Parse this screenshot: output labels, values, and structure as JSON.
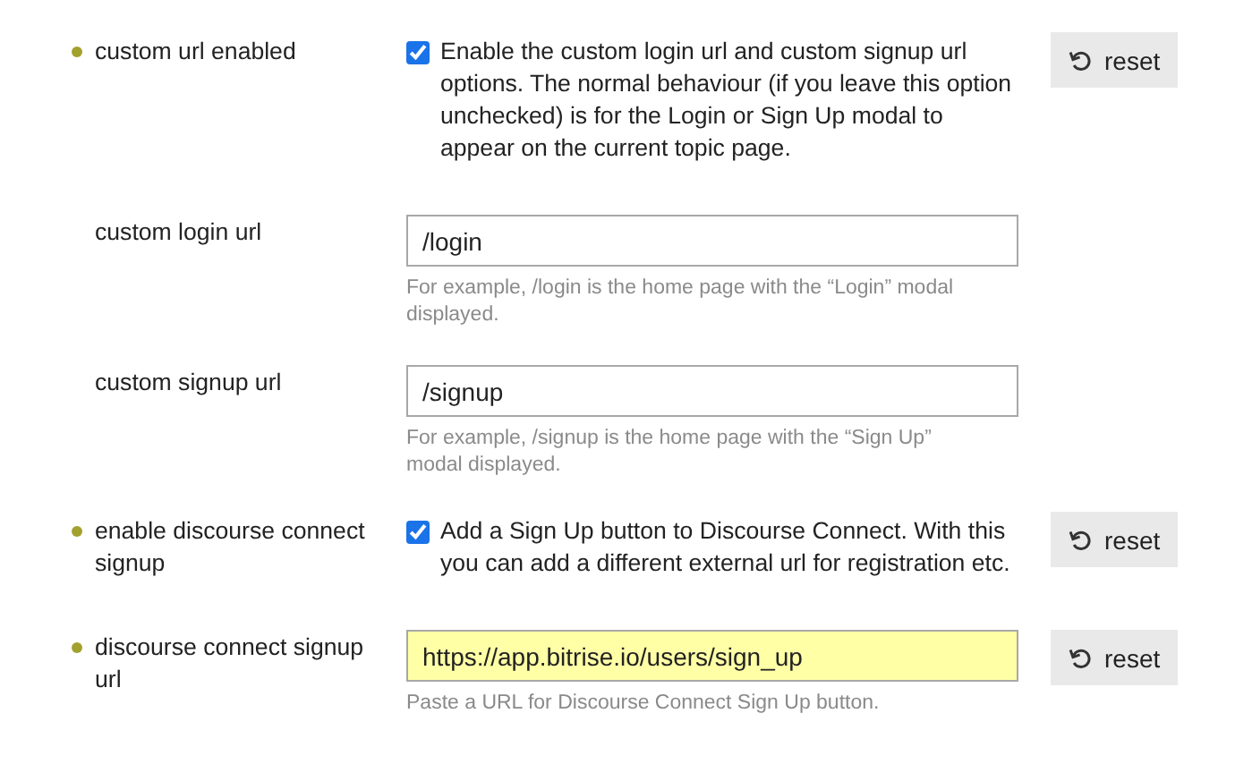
{
  "settings": [
    {
      "kind": "checkbox",
      "label": "custom url enabled",
      "modified": true,
      "checked": true,
      "description": "Enable the custom login url and custom signup url options. The normal behaviour (if you leave this option unchecked) is for the Login or Sign Up modal to appear on the current topic page.",
      "reset": "reset"
    },
    {
      "kind": "text",
      "label": "custom login url",
      "modified": false,
      "value": "/login",
      "highlighted": false,
      "hint": "For example, /login is the home page with the “Login” modal displayed."
    },
    {
      "kind": "text",
      "label": "custom signup url",
      "modified": false,
      "value": "/signup",
      "highlighted": false,
      "hint": "For example, /signup is the home page with the “Sign Up” modal displayed."
    },
    {
      "kind": "checkbox",
      "label": "enable discourse connect signup",
      "modified": true,
      "checked": true,
      "description": "Add a Sign Up button to Discourse Connect. With this you can add a different external url for registration etc.",
      "reset": "reset"
    },
    {
      "kind": "text",
      "label": "discourse connect signup url",
      "modified": true,
      "value": "https://app.bitrise.io/users/sign_up",
      "highlighted": true,
      "hint": "Paste a URL for Discourse Connect Sign Up button.",
      "reset": "reset"
    }
  ]
}
